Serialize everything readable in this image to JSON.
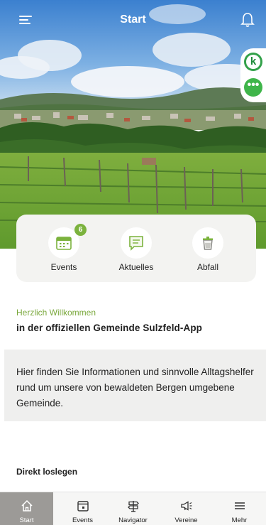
{
  "header": {
    "title": "Start"
  },
  "icons": {
    "menu": "hamburger-menu-icon",
    "notifications": "bell-icon",
    "side_logo": "k",
    "side_more": "•••"
  },
  "quick_actions": [
    {
      "label": "Events",
      "icon": "calendar-icon",
      "badge": "6"
    },
    {
      "label": "Aktuelles",
      "icon": "news-icon"
    },
    {
      "label": "Abfall",
      "icon": "waste-bin-icon"
    }
  ],
  "welcome": {
    "subtitle": "Herzlich Willkommen",
    "title": "in der offiziellen Gemeinde Sulzfeld-App"
  },
  "info_text": "Hier finden Sie Informationen und sinnvolle Alltagshelfer rund um unsere von bewaldeten Bergen umgebene Gemeinde.",
  "section_heading": "Direkt loslegen",
  "bottom_nav": [
    {
      "label": "Start",
      "icon": "home-icon",
      "active": true
    },
    {
      "label": "Events",
      "icon": "calendar-icon"
    },
    {
      "label": "Navigator",
      "icon": "signpost-icon"
    },
    {
      "label": "Vereine",
      "icon": "megaphone-icon"
    },
    {
      "label": "Mehr",
      "icon": "menu-icon"
    }
  ],
  "colors": {
    "accent_green": "#7bb23d",
    "active_tab": "#9c9a97",
    "sky": "#4f8fd6"
  }
}
